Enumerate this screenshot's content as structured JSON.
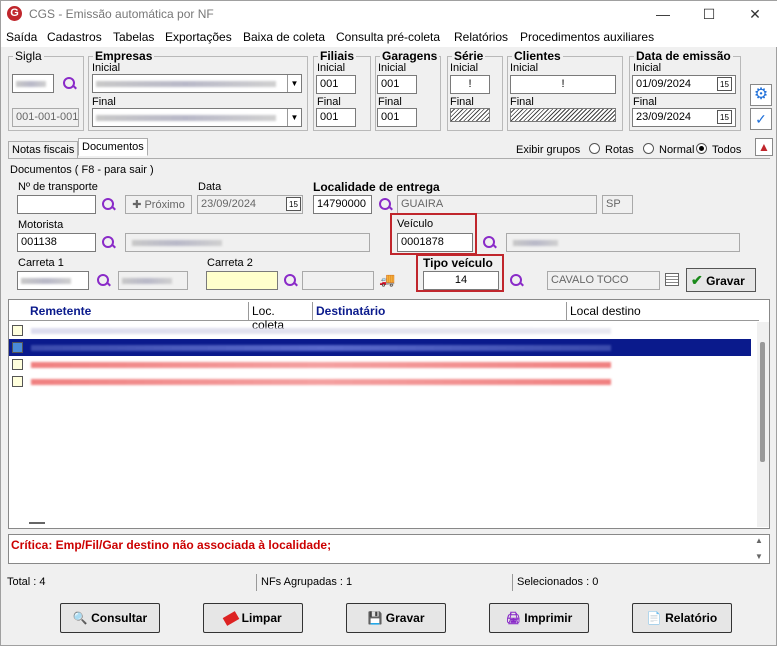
{
  "title": "CGS - Emissão automática por NF",
  "menu": [
    "Saída",
    "Cadastros",
    "Tabelas",
    "Exportações",
    "Baixa de coleta",
    "Consulta pré-coleta",
    "Relatórios",
    "Procedimentos auxiliares"
  ],
  "groups": {
    "sigla": "Sigla",
    "empresas": "Empresas",
    "filiais": "Filiais",
    "garagens": "Garagens",
    "serie": "Série",
    "clientes": "Clientes",
    "data": "Data de emissão"
  },
  "labels": {
    "inicial": "Inicial",
    "final": "Final"
  },
  "sigla_value": "001-001-001",
  "filiais": {
    "inicial": "001",
    "final": "001"
  },
  "garagens": {
    "inicial": "001",
    "final": "001"
  },
  "serie": {
    "inicial": "!"
  },
  "clientes": {
    "inicial": "!"
  },
  "datas": {
    "inicial": "01/09/2024",
    "final": "23/09/2024"
  },
  "tabs": [
    "Notas fiscais",
    "Documentos"
  ],
  "exibir": {
    "label": "Exibir grupos",
    "rotas": "Rotas",
    "normal": "Normal",
    "todos": "Todos"
  },
  "section_title": "Documentos ( F8 - para sair )",
  "form": {
    "transporte_label": "Nº de transporte",
    "proximo": "Próximo",
    "data_label": "Data",
    "data_value": "23/09/2024",
    "localidade_label": "Localidade de entrega",
    "localidade_code": "14790000",
    "localidade_name": "GUAIRA",
    "uf": "SP",
    "motorista_label": "Motorista",
    "motorista_value": "001138",
    "veiculo_label": "Veículo",
    "veiculo_value": "0001878",
    "carreta1_label": "Carreta 1",
    "carreta2_label": "Carreta 2",
    "tipo_label": "Tipo veículo",
    "tipo_value": "14",
    "tipo_desc": "CAVALO TOCO",
    "gravar": "Gravar"
  },
  "grid": {
    "headers": [
      "Remetente",
      "Loc. coleta",
      "Destinatário",
      "Local destino"
    ]
  },
  "error": "Crítica: Emp/Fil/Gar destino não associada à localidade;",
  "status": {
    "total": "Total : 4",
    "agrupadas": "NFs Agrupadas : 1",
    "selecionados": "Selecionados : 0"
  },
  "buttons": {
    "consultar": "Consultar",
    "limpar": "Limpar",
    "gravar": "Gravar",
    "imprimir": "Imprimir",
    "relatorio": "Relatório"
  },
  "colors": {
    "accent": "#0a1a8c",
    "error": "#cc0000",
    "highlight": "#c0262c"
  }
}
